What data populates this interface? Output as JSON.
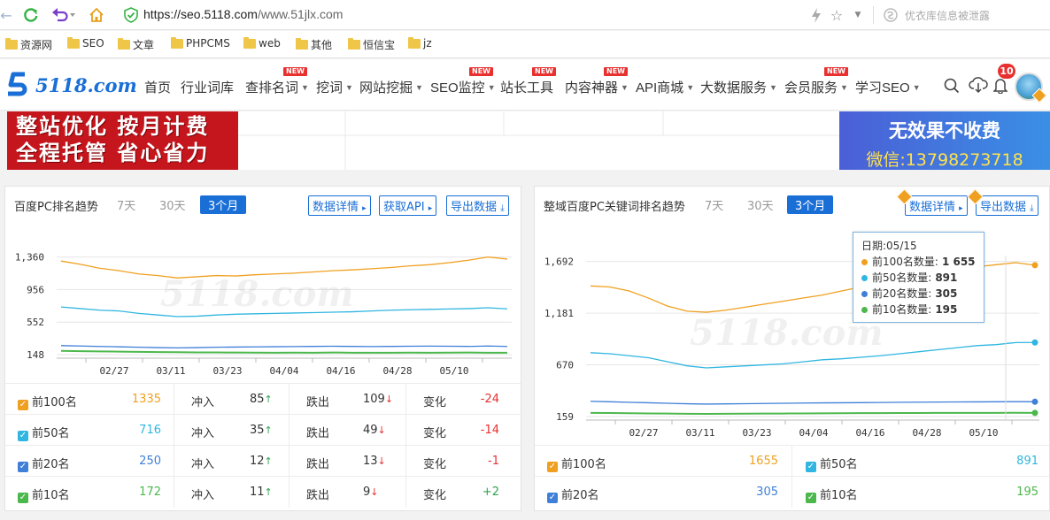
{
  "browser": {
    "url_host": "https://seo.5118.com",
    "url_path": "/www.51jlx.com",
    "search_placeholder": "优衣库信息被泄露"
  },
  "bookmarks": [
    "资源网",
    "SEO",
    "文章",
    "PHPCMS",
    "web",
    "其他",
    "恒信宝",
    "jz"
  ],
  "site": {
    "logo_text": "5118.com",
    "nav": [
      {
        "label": "首页",
        "caret": false,
        "new": false
      },
      {
        "label": "行业词库",
        "caret": false,
        "new": false
      },
      {
        "label": "查排名词",
        "caret": true,
        "new": true
      },
      {
        "label": "挖词",
        "caret": true,
        "new": false
      },
      {
        "label": "网站挖掘",
        "caret": true,
        "new": false
      },
      {
        "label": "SEO监控",
        "caret": true,
        "new": true
      },
      {
        "label": "站长工具",
        "caret": false,
        "new": true
      },
      {
        "label": "内容神器",
        "caret": true,
        "new": true
      },
      {
        "label": "API商城",
        "caret": true,
        "new": false
      },
      {
        "label": "大数据服务",
        "caret": true,
        "new": false
      },
      {
        "label": "会员服务",
        "caret": true,
        "new": true
      },
      {
        "label": "学习SEO",
        "caret": true,
        "new": false
      }
    ],
    "new_label": "NEW",
    "notification_count": "10"
  },
  "banners": {
    "left_line1": "整站优化 按月计费",
    "left_line2": "全程托管 省心省力",
    "right_line1": "无效果不收费",
    "right_line2": "微信:13798273718"
  },
  "panel_left": {
    "title": "百度PC排名趋势",
    "tabs": [
      "7天",
      "30天",
      "3个月"
    ],
    "active_tab": "3个月",
    "buttons": [
      "数据详情",
      "获取API",
      "导出数据"
    ],
    "stats": [
      {
        "name": "前100名",
        "value": "1335",
        "color": "#f0a020",
        "in_label": "冲入",
        "in": "85",
        "out_label": "跌出",
        "out": "109",
        "change_label": "变化",
        "change": "-24"
      },
      {
        "name": "前50名",
        "value": "716",
        "color": "#30b6e0",
        "in_label": "冲入",
        "in": "35",
        "out_label": "跌出",
        "out": "49",
        "change_label": "变化",
        "change": "-14"
      },
      {
        "name": "前20名",
        "value": "250",
        "color": "#3f7fd8",
        "in_label": "冲入",
        "in": "12",
        "out_label": "跌出",
        "out": "13",
        "change_label": "变化",
        "change": "-1"
      },
      {
        "name": "前10名",
        "value": "172",
        "color": "#4cb84c",
        "in_label": "冲入",
        "in": "11",
        "out_label": "跌出",
        "out": "9",
        "change_label": "变化",
        "change": "+2"
      }
    ]
  },
  "panel_right": {
    "title": "整域百度PC关键词排名趋势",
    "tabs": [
      "7天",
      "30天",
      "3个月"
    ],
    "active_tab": "3个月",
    "buttons": [
      "数据详情",
      "导出数据"
    ],
    "stats": [
      {
        "name": "前100名",
        "value": "1655",
        "color": "#f0a020"
      },
      {
        "name": "前50名",
        "value": "891",
        "color": "#30b6e0"
      },
      {
        "name": "前20名",
        "value": "305",
        "color": "#3f7fd8"
      },
      {
        "name": "前10名",
        "value": "195",
        "color": "#4cb84c"
      }
    ],
    "tooltip": {
      "date_label": "日期:05/15",
      "rows": [
        {
          "label": "前100名数量:",
          "value": "1 655",
          "color": "#f0a020"
        },
        {
          "label": "前50名数量:",
          "value": "891",
          "color": "#30b6e0"
        },
        {
          "label": "前20名数量:",
          "value": "305",
          "color": "#3f7fd8"
        },
        {
          "label": "前10名数量:",
          "value": "195",
          "color": "#4cb84c"
        }
      ]
    }
  },
  "watermark": "5118.com",
  "chart_data": [
    {
      "type": "line",
      "title": "百度PC排名趋势",
      "x": [
        "02/27",
        "03/11",
        "03/23",
        "04/04",
        "04/16",
        "04/28",
        "05/10"
      ],
      "yticks": [
        148,
        552,
        956,
        1360
      ],
      "ylim": [
        148,
        1400
      ],
      "series": [
        {
          "name": "前100名",
          "color": "#f0a020",
          "values": [
            1310,
            1270,
            1220,
            1190,
            1150,
            1130,
            1100,
            1115,
            1130,
            1125,
            1140,
            1150,
            1160,
            1175,
            1190,
            1200,
            1215,
            1230,
            1250,
            1265,
            1290,
            1320,
            1360,
            1335
          ]
        },
        {
          "name": "前50名",
          "color": "#30b6e0",
          "values": [
            740,
            720,
            700,
            690,
            660,
            640,
            620,
            625,
            640,
            650,
            655,
            660,
            665,
            670,
            675,
            680,
            690,
            700,
            705,
            710,
            715,
            720,
            730,
            716
          ]
        },
        {
          "name": "前20名",
          "color": "#3f7fd8",
          "values": [
            260,
            255,
            250,
            245,
            240,
            235,
            232,
            235,
            240,
            242,
            244,
            246,
            248,
            250,
            252,
            250,
            248,
            250,
            252,
            254,
            252,
            250,
            255,
            250
          ]
        },
        {
          "name": "前10名",
          "color": "#4cb84c",
          "values": [
            195,
            190,
            188,
            185,
            182,
            180,
            178,
            176,
            175,
            174,
            173,
            172,
            173,
            172,
            174,
            172,
            171,
            172,
            173,
            172,
            173,
            174,
            172,
            172
          ]
        }
      ]
    },
    {
      "type": "line",
      "title": "整域百度PC关键词排名趋势",
      "x": [
        "02/27",
        "03/11",
        "03/23",
        "04/04",
        "04/16",
        "04/28",
        "05/10"
      ],
      "yticks": [
        159,
        670,
        1181,
        1692
      ],
      "ylim": [
        159,
        1750
      ],
      "series": [
        {
          "name": "前100名",
          "color": "#f0a020",
          "values": [
            1450,
            1440,
            1400,
            1330,
            1250,
            1200,
            1190,
            1210,
            1240,
            1270,
            1300,
            1330,
            1360,
            1400,
            1440,
            1480,
            1520,
            1560,
            1590,
            1610,
            1640,
            1660,
            1680,
            1655
          ]
        },
        {
          "name": "前50名",
          "color": "#30b6e0",
          "values": [
            790,
            780,
            760,
            740,
            700,
            660,
            640,
            650,
            660,
            670,
            680,
            700,
            720,
            730,
            745,
            760,
            780,
            800,
            820,
            840,
            860,
            870,
            890,
            891
          ]
        },
        {
          "name": "前20名",
          "color": "#3f7fd8",
          "values": [
            310,
            305,
            300,
            295,
            290,
            285,
            282,
            284,
            286,
            288,
            290,
            292,
            294,
            295,
            296,
            298,
            300,
            301,
            302,
            303,
            304,
            305,
            306,
            305
          ]
        },
        {
          "name": "前10名",
          "color": "#4cb84c",
          "values": [
            195,
            194,
            192,
            190,
            188,
            186,
            185,
            186,
            187,
            188,
            189,
            190,
            191,
            192,
            193,
            193,
            194,
            194,
            195,
            195,
            195,
            195,
            196,
            195
          ]
        }
      ]
    }
  ]
}
